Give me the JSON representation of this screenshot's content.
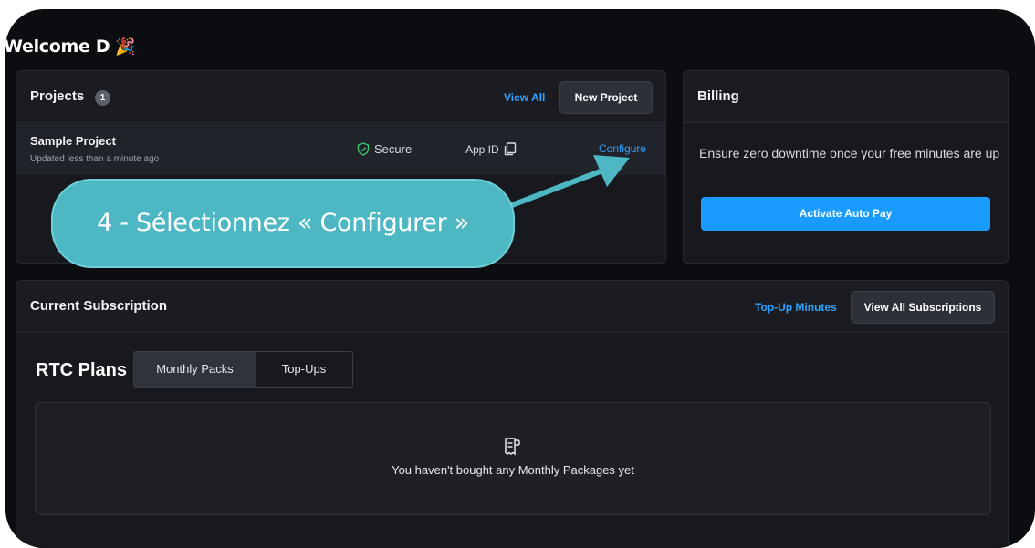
{
  "welcome": {
    "title": "Welcome D",
    "emoji": "🎉"
  },
  "projects": {
    "title": "Projects",
    "count": "1",
    "view_all": "View All",
    "new_project": "New Project",
    "items": [
      {
        "name": "Sample Project",
        "updated": "Updated less than a minute ago",
        "status": "Secure",
        "app_id_label": "App ID",
        "configure": "Configure"
      }
    ]
  },
  "billing": {
    "title": "Billing",
    "text": "Ensure zero downtime once your free minutes are up",
    "button": "Activate Auto Pay"
  },
  "subscription": {
    "title": "Current Subscription",
    "topup_link": "Top-Up Minutes",
    "view_all": "View All Subscriptions",
    "plans_title": "RTC Plans",
    "tabs": [
      {
        "label": "Monthly Packs",
        "active": true
      },
      {
        "label": "Top-Ups",
        "active": false
      }
    ],
    "empty_text": "You haven't bought any Monthly Packages yet"
  },
  "annotation": {
    "text": "4 - Sélectionnez « Configurer »"
  },
  "colors": {
    "accent": "#1a9bff",
    "link": "#2fa3ff",
    "callout": "#4db7c3",
    "secure": "#3cc66b"
  }
}
